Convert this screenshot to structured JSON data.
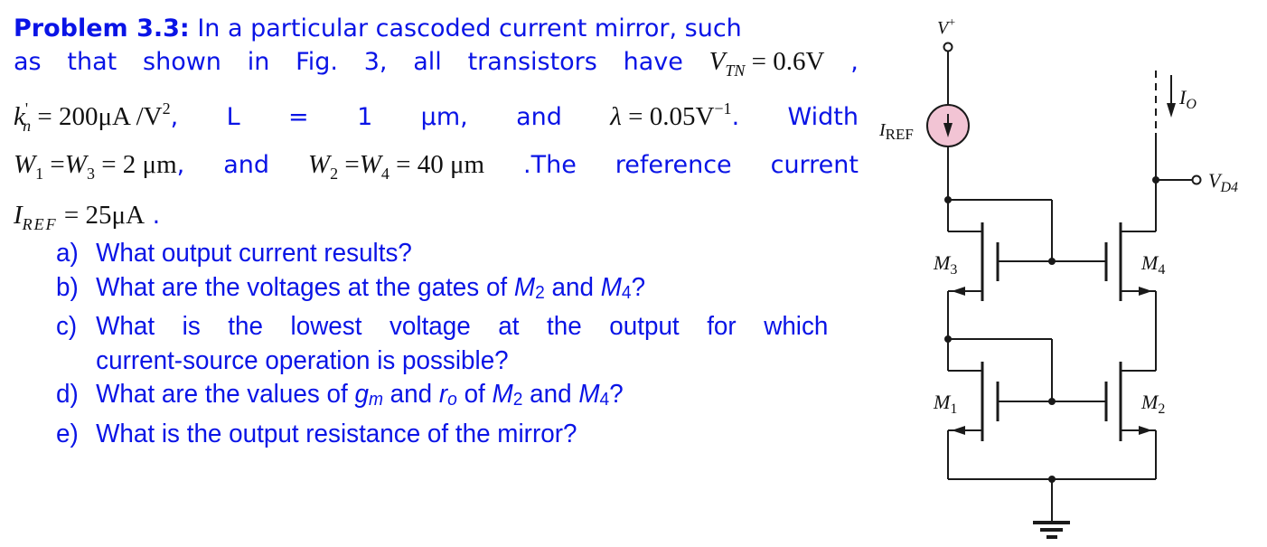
{
  "problem": {
    "heading": "Problem 3.3:",
    "line1_text": "In a particular cascoded current mirror, such",
    "line2_words": [
      "as",
      "that",
      "shown",
      "in",
      "Fig.",
      "3,",
      "all",
      "transistors",
      "have"
    ],
    "vtn": {
      "symbol": "V",
      "sub": "TN",
      "value": "= 0.6V",
      "trail": ","
    },
    "kn": {
      "symbol": "k",
      "prime": "'",
      "sub": "n",
      "value": "= 200μA /V",
      "exp": "2",
      "trail": ","
    },
    "L": {
      "symbol": "L",
      "eq": "=",
      "value": "1",
      "unit": "μm,"
    },
    "and_word": "and",
    "lambda": {
      "symbol": "λ",
      "value": "= 0.05V",
      "exp": "−1",
      "trail": "."
    },
    "width_word": "Width",
    "w13": {
      "w1": "W",
      "w1_sub": "1",
      "w3": "W",
      "w3_sub": "3",
      "value": "= 2 μm",
      "trail": ","
    },
    "and2_word": "and",
    "w24": {
      "w2": "W",
      "w2_sub": "2",
      "w4": "W",
      "w4_sub": "4",
      "value": "= 40 μm"
    },
    "ref_words": [
      ".The",
      "reference",
      "current"
    ],
    "iref": {
      "symbol": "I",
      "sub": "REF",
      "value": "= 25μA",
      "trail": "."
    }
  },
  "questions": [
    {
      "label": "a)",
      "text": "What output current results?"
    },
    {
      "label": "b)",
      "pre": "What are the voltages at the gates of ",
      "m2": "M",
      "m2_sub": "2",
      "mid": " and ",
      "m4": "M",
      "m4_sub": "4",
      "post": "?"
    },
    {
      "label": "c)",
      "text": "What is the lowest voltage at the output for which",
      "cont": "current-source operation is possible?"
    },
    {
      "label": "d)",
      "pre": "What are the values of ",
      "gm": "g",
      "gm_sub": "m",
      "mid1": " and ",
      "ro": "r",
      "ro_sub": "o",
      "mid2": " of ",
      "m2": "M",
      "m2_sub": "2",
      "mid3": " and ",
      "m4": "M",
      "m4_sub": "4",
      "post": "?"
    },
    {
      "label": "e)",
      "text": "What is the output resistance of the mirror?"
    }
  ],
  "schematic": {
    "vplus": "V",
    "vplus_sup": "+",
    "iref_label": "I",
    "iref_sub": "REF",
    "io_label": "I",
    "io_sub": "O",
    "vd4_label": "V",
    "vd4_sub": "D4",
    "transistors": [
      {
        "name": "M",
        "sub": "3"
      },
      {
        "name": "M",
        "sub": "4"
      },
      {
        "name": "M",
        "sub": "1"
      },
      {
        "name": "M",
        "sub": "2"
      }
    ],
    "colors": {
      "source_fill": "#f2c4d4",
      "wire": "#1a1a1a",
      "text_blue": "#0a14e6"
    }
  }
}
